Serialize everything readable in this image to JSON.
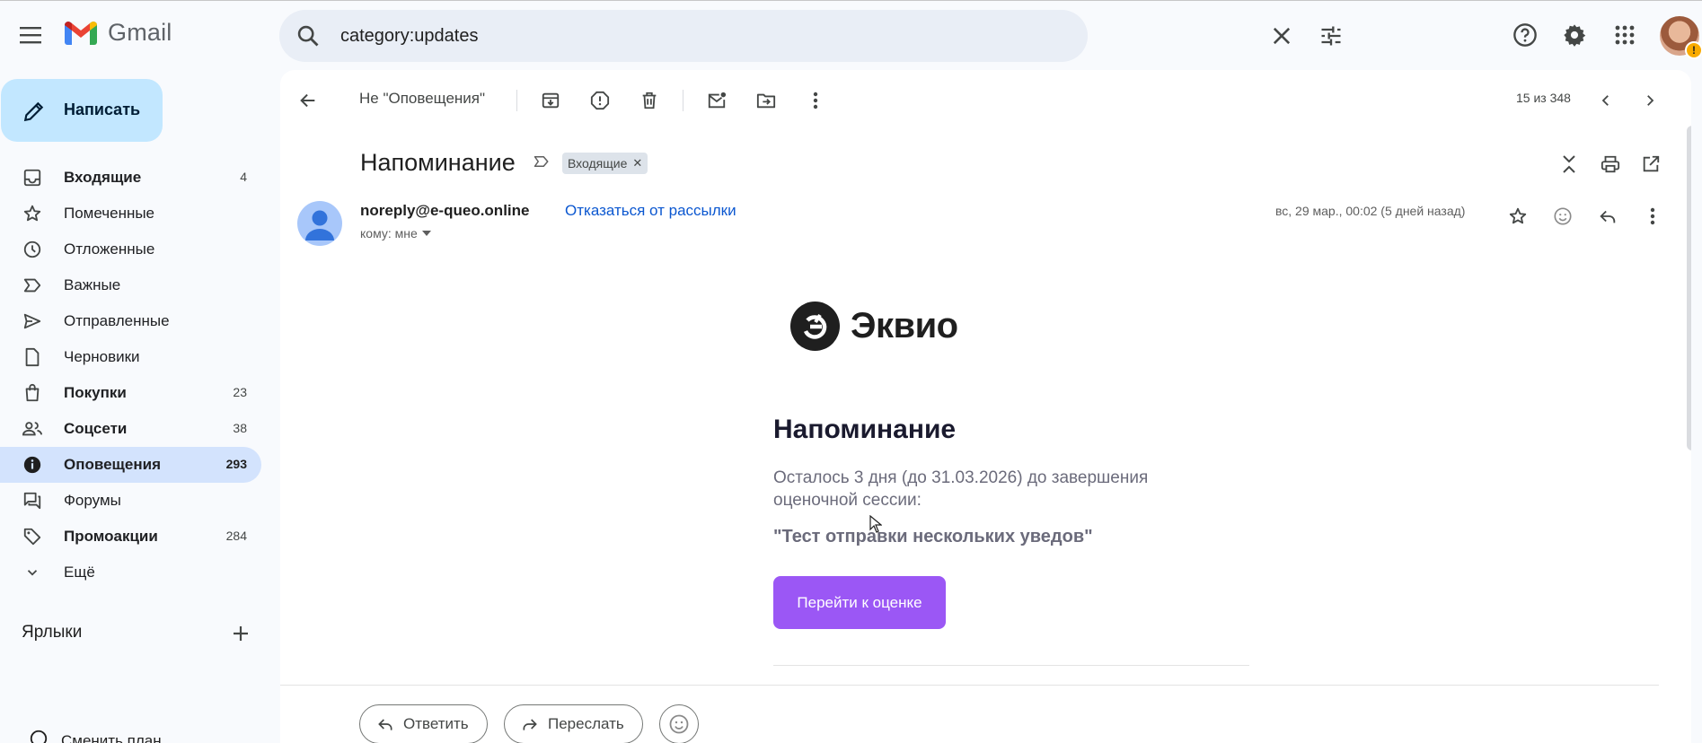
{
  "app": {
    "name": "Gmail"
  },
  "search": {
    "value": "category:updates"
  },
  "compose": {
    "label": "Написать"
  },
  "sidebar": {
    "items": [
      {
        "label": "Входящие",
        "count": "4",
        "bold": true,
        "icon": "inbox-icon"
      },
      {
        "label": "Помеченные",
        "count": "",
        "bold": false,
        "icon": "star-icon"
      },
      {
        "label": "Отложенные",
        "count": "",
        "bold": false,
        "icon": "clock-icon"
      },
      {
        "label": "Важные",
        "count": "",
        "bold": false,
        "icon": "important-icon"
      },
      {
        "label": "Отправленные",
        "count": "",
        "bold": false,
        "icon": "send-icon"
      },
      {
        "label": "Черновики",
        "count": "",
        "bold": false,
        "icon": "draft-icon"
      },
      {
        "label": "Покупки",
        "count": "23",
        "bold": true,
        "icon": "shopping-icon"
      },
      {
        "label": "Соцсети",
        "count": "38",
        "bold": true,
        "icon": "people-icon"
      },
      {
        "label": "Оповещения",
        "count": "293",
        "bold": true,
        "icon": "info-icon",
        "active": true
      },
      {
        "label": "Форумы",
        "count": "",
        "bold": false,
        "icon": "forum-icon"
      },
      {
        "label": "Промоакции",
        "count": "284",
        "bold": true,
        "icon": "tag-icon"
      },
      {
        "label": "Ещё",
        "count": "",
        "bold": false,
        "icon": "chevron-down-icon"
      }
    ],
    "labels_heading": "Ярлыки",
    "upgrade_label": "Сменить план"
  },
  "toolbar": {
    "not_updates": "Не \"Оповещения\"",
    "pager": "15 из 348"
  },
  "message": {
    "subject": "Напоминание",
    "label_chip": "Входящие",
    "sender": "noreply@e-queo.online",
    "unsubscribe": "Отказаться от рассылки",
    "to": "кому: мне",
    "date": "вс, 29 мар., 00:02 (5 дней назад)"
  },
  "email_body": {
    "brand": "Эквио",
    "title": "Напоминание",
    "text": "Осталось 3 дня (до 31.03.2026) до завершения оценочной сессии:",
    "quote": "\"Тест отправки нескольких уведов\"",
    "cta": "Перейти к оценке",
    "cta_color": "#9b57f5"
  },
  "actions": {
    "reply": "Ответить",
    "forward": "Переслать"
  },
  "colors": {
    "accent": "#0b57d0",
    "active_nav": "#d3e3fd",
    "compose": "#c2e7ff"
  }
}
